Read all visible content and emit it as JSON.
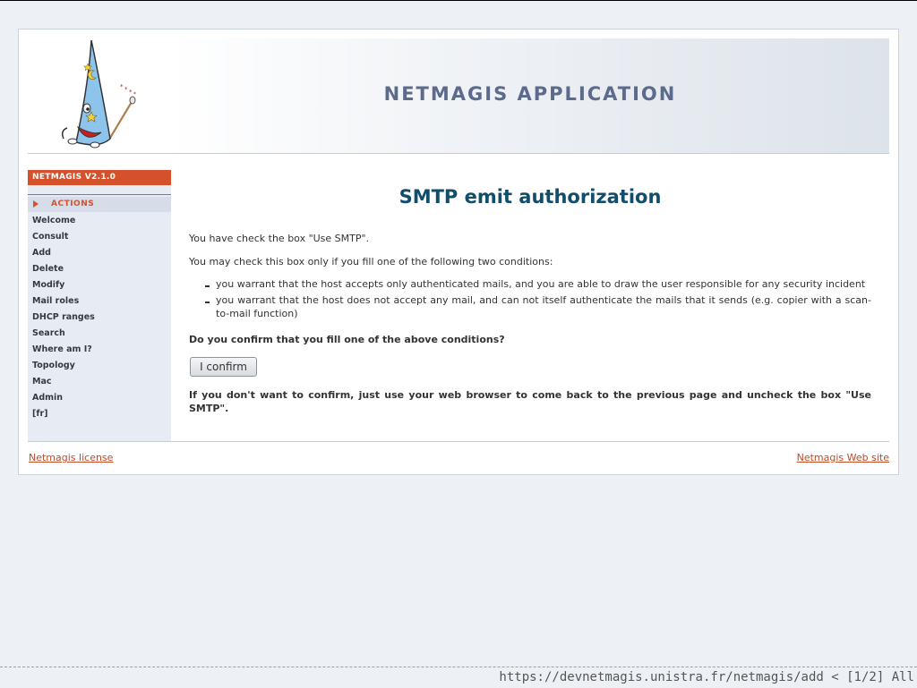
{
  "header": {
    "app_title": "NETMAGIS APPLICATION"
  },
  "sidebar": {
    "version": "NETMAGIS V2.1.0",
    "section_label": "ACTIONS",
    "items": [
      {
        "label": "Welcome"
      },
      {
        "label": "Consult"
      },
      {
        "label": "Add"
      },
      {
        "label": "Delete"
      },
      {
        "label": "Modify"
      },
      {
        "label": "Mail roles"
      },
      {
        "label": "DHCP ranges"
      },
      {
        "label": "Search"
      },
      {
        "label": "Where am I?"
      },
      {
        "label": "Topology"
      },
      {
        "label": "Mac"
      },
      {
        "label": "Admin"
      },
      {
        "label": "[fr]"
      }
    ]
  },
  "main": {
    "title": "SMTP emit authorization",
    "para1": "You have check the box \"Use SMTP\".",
    "para2": "You may check this box only if you fill one of the following two conditions:",
    "conditions": [
      "you warrant that the host accepts only authenticated mails, and you are able to draw the user responsible for any security incident",
      "you warrant that the host does not accept any mail, and can not itself authenticate the mails that it sends (e.g. copier with a scan-to-mail function)"
    ],
    "question": "Do you confirm that you fill one of the above conditions?",
    "confirm_label": "I confirm",
    "warning": "If you don't want to confirm, just use your web browser to come back to the previous page and uncheck the box \"Use SMTP\"."
  },
  "footer": {
    "license_link": "Netmagis license",
    "site_link": "Netmagis Web site"
  },
  "status_bar": {
    "url_text": "https://devnetmagis.unistra.fr/netmagis/add < [1/2] All"
  },
  "colors": {
    "accent": "#d4512b",
    "title": "#124e6b",
    "banner_text": "#5c6a8c",
    "sidebar_bg": "#e7ecf4"
  }
}
